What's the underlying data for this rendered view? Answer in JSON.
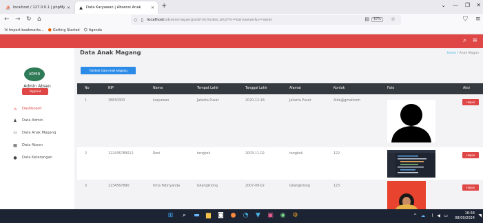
{
  "browser": {
    "tabs": [
      {
        "label": "localhost / 127.0.0.1 | phpMyA",
        "active": false
      },
      {
        "label": "Data Karyawan | Absensi Anak",
        "active": true
      }
    ],
    "url_host": "localhost",
    "url_path": "/absenmagang/admin/index.php?m=karyawan&s=awal",
    "zoom": "67%",
    "bookmarks": [
      {
        "label": "Import bookmarks...",
        "icon": "import-icon"
      },
      {
        "label": "Getting Started",
        "icon": "firefox-icon"
      },
      {
        "label": "Agenda",
        "icon": "agenda-icon"
      }
    ]
  },
  "sidebar": {
    "logo_text": "ADMIN",
    "admin_name": "Admin Absen",
    "signout_label": "Signout",
    "items": [
      {
        "label": "Dashboard",
        "icon": "home-icon",
        "active": true
      },
      {
        "label": "Data Admin",
        "icon": "user-icon",
        "active": false
      },
      {
        "label": "Data Anak Magang",
        "icon": "users-icon",
        "active": false
      },
      {
        "label": "Data Absen",
        "icon": "calendar-icon",
        "active": false
      },
      {
        "label": "Data Keterangan",
        "icon": "info-icon",
        "active": false
      }
    ]
  },
  "main": {
    "title": "Data Anak Magang",
    "breadcrumb_home": "Home",
    "breadcrumb_current": "Anak Magan",
    "add_button": "Tambah Data Anak Magang",
    "columns": [
      "No",
      "NIP",
      "Nama",
      "Tempat Lahir",
      "Tanggal Lahir",
      "Alamat",
      "Kontak",
      "Foto",
      "Aksi"
    ],
    "rows": [
      {
        "no": "1",
        "nip": "38830303",
        "nama": "karyawan",
        "tempat_lahir": "Jakarta Pusat",
        "tanggal_lahir": "2020-12-18",
        "alamat": "Jakarta Pusat",
        "kontak": "Alda@gmailcom",
        "foto": "silhouette",
        "aksi": "Hapus"
      },
      {
        "no": "2",
        "nip": "122436789012",
        "nama": "Reni",
        "tempat_lahir": "tangkok",
        "tanggal_lahir": "2003-11-02",
        "alamat": "tangkok",
        "kontak": "122",
        "foto": "code-screenshot",
        "aksi": "Hapus"
      },
      {
        "no": "3",
        "nip": "1234567890",
        "nama": "Irma Febriyanda",
        "tempat_lahir": "Gilangkilong",
        "tanggal_lahir": "2007-09-02",
        "alamat": "Gilangkilong",
        "kontak": "123",
        "foto": "person-photo",
        "aksi": "Hapus"
      }
    ]
  },
  "taskbar": {
    "time": "16:58",
    "date": "08/09/2024"
  },
  "colors": {
    "accent_red": "#df4747",
    "primary_blue": "#2d8be8",
    "table_header": "#343a40"
  }
}
